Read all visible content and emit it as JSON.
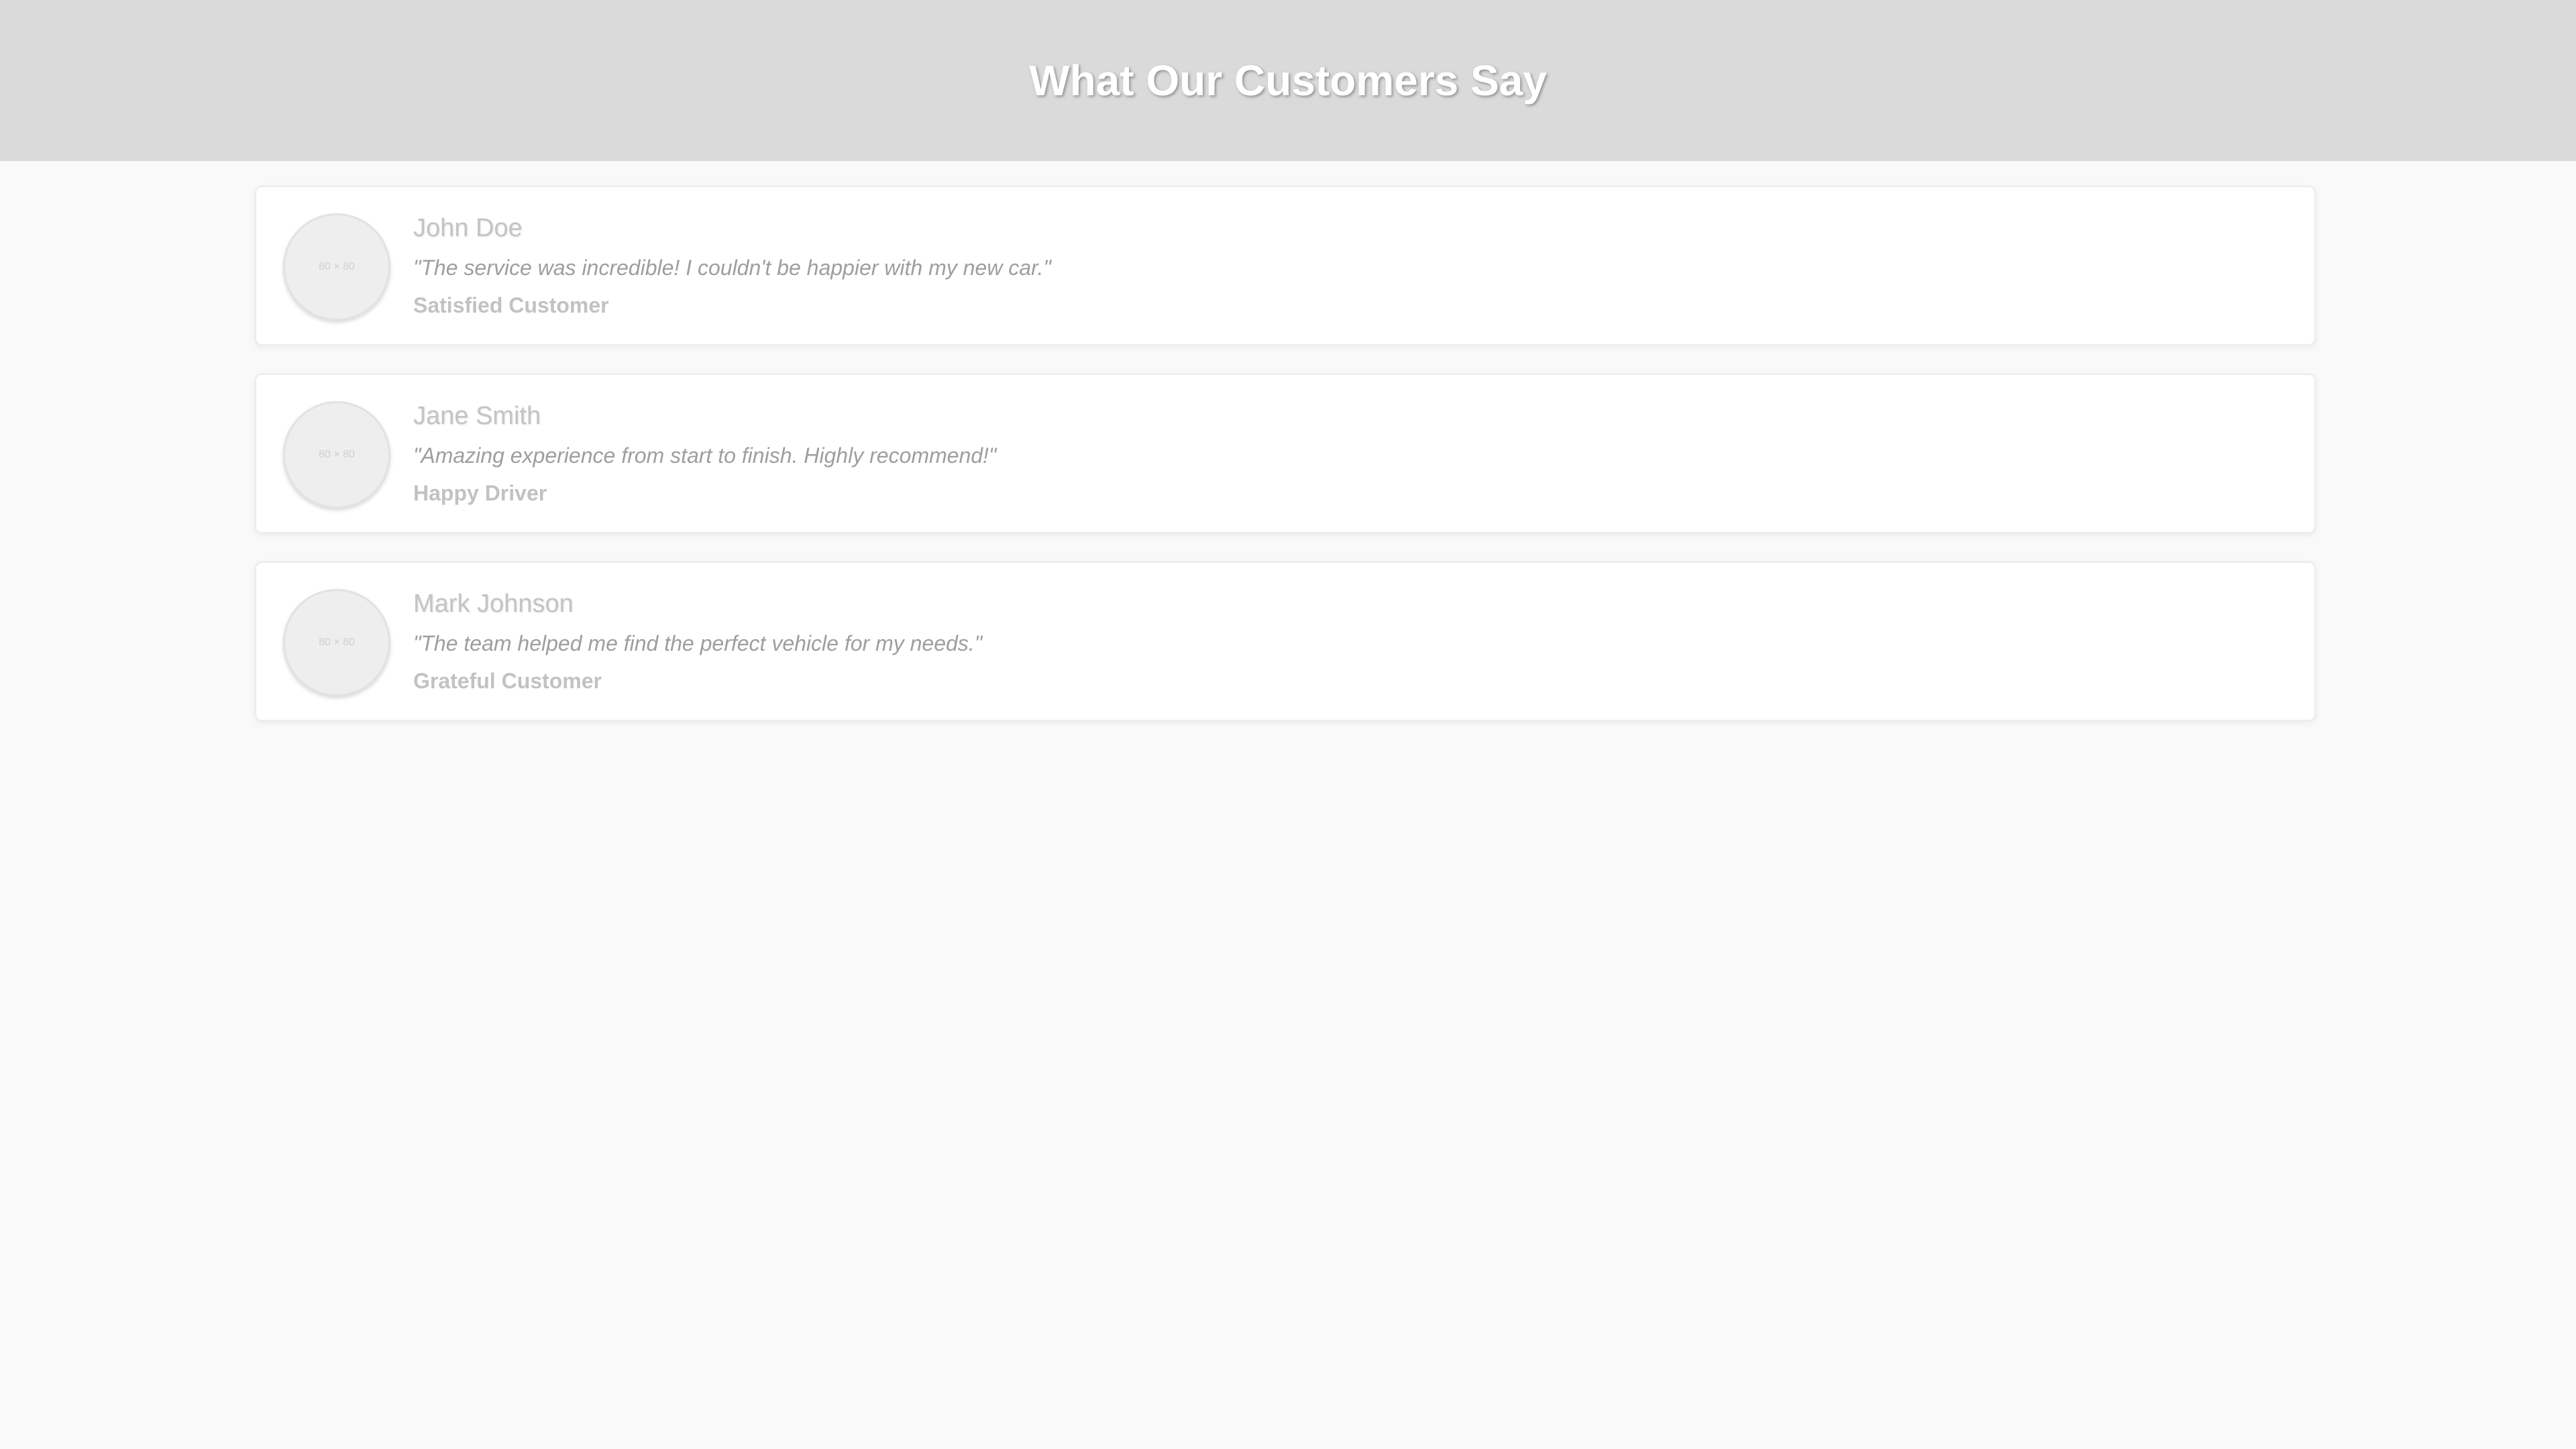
{
  "header": {
    "title": "What Our Customers Say"
  },
  "testimonials": [
    {
      "avatar_text": "80 × 80",
      "name": "John Doe",
      "quote": "\"The service was incredible! I couldn't be happier with my new car.\"",
      "role": "Satisfied Customer"
    },
    {
      "avatar_text": "80 × 80",
      "name": "Jane Smith",
      "quote": "\"Amazing experience from start to finish. Highly recommend!\"",
      "role": "Happy Driver"
    },
    {
      "avatar_text": "80 × 80",
      "name": "Mark Johnson",
      "quote": "\"The team helped me find the perfect vehicle for my needs.\"",
      "role": "Grateful Customer"
    }
  ],
  "colors": {
    "header_background": "#dadada",
    "page_background": "#f9f9f9",
    "card_background": "#ffffff",
    "title_text": "#ffffff"
  }
}
